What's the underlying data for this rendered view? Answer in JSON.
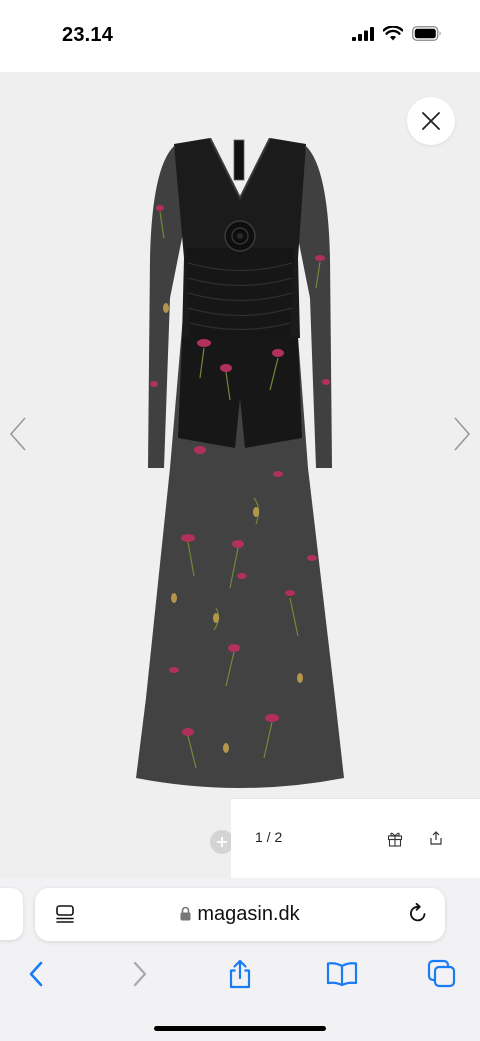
{
  "status_bar": {
    "time": "23.14"
  },
  "gallery": {
    "image_alt": "Black floral maxi dress",
    "counter": "1 / 2"
  },
  "browser": {
    "url": "magasin.dk"
  },
  "colors": {
    "accent": "#1a7cf5",
    "gallery_bg": "#efefef"
  },
  "icons": [
    "signal-icon",
    "wifi-icon",
    "battery-icon",
    "close-icon",
    "chevron-left-icon",
    "chevron-right-icon",
    "zoom-in-icon",
    "zoom-out-icon",
    "gift-icon",
    "share-icon",
    "reader-icon",
    "lock-icon",
    "reload-icon",
    "back-icon",
    "forward-icon",
    "bookmarks-icon",
    "tabs-icon"
  ]
}
